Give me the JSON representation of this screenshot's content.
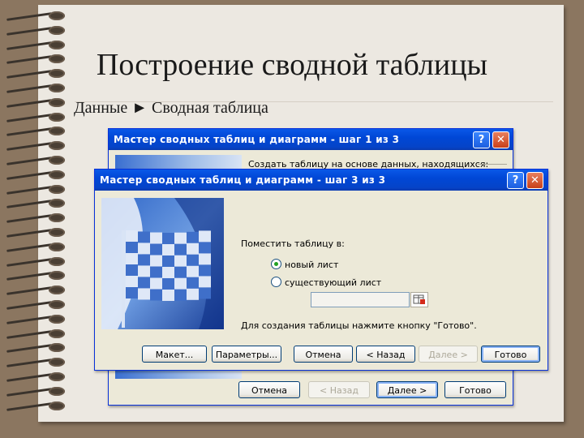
{
  "slide": {
    "title": "Построение сводной таблицы",
    "subtitle": "Данные ► Сводная таблица"
  },
  "dialog_back": {
    "title": "Мастер сводных таблиц и диаграмм - шаг 1 из 3",
    "help_label": "?",
    "close_label": "✕",
    "source_text": "Создать таблицу на основе данных, находящихся:",
    "cancel_label": "Отмена",
    "back_label": "< Назад",
    "next_label": "Далее >",
    "finish_label": "Готово"
  },
  "dialog_front": {
    "title": "Мастер сводных таблиц и диаграмм - шаг 3 из 3",
    "help_label": "?",
    "close_label": "✕",
    "place_label": "Поместить таблицу в:",
    "options": [
      {
        "label": "новый лист",
        "selected": true
      },
      {
        "label": "существующий лист",
        "selected": false
      }
    ],
    "range_value": "",
    "hint": "Для создания таблицы нажмите кнопку \"Готово\".",
    "layout_label": "Макет...",
    "params_label": "Параметры...",
    "cancel_label": "Отмена",
    "back_label": "< Назад",
    "next_label": "Далее >",
    "finish_label": "Готово"
  },
  "colors": {
    "titlebar": "#0a58e8",
    "dialog_bg": "#ece9d8",
    "slide_bg": "#ece8e1",
    "frame": "#8b7660"
  }
}
